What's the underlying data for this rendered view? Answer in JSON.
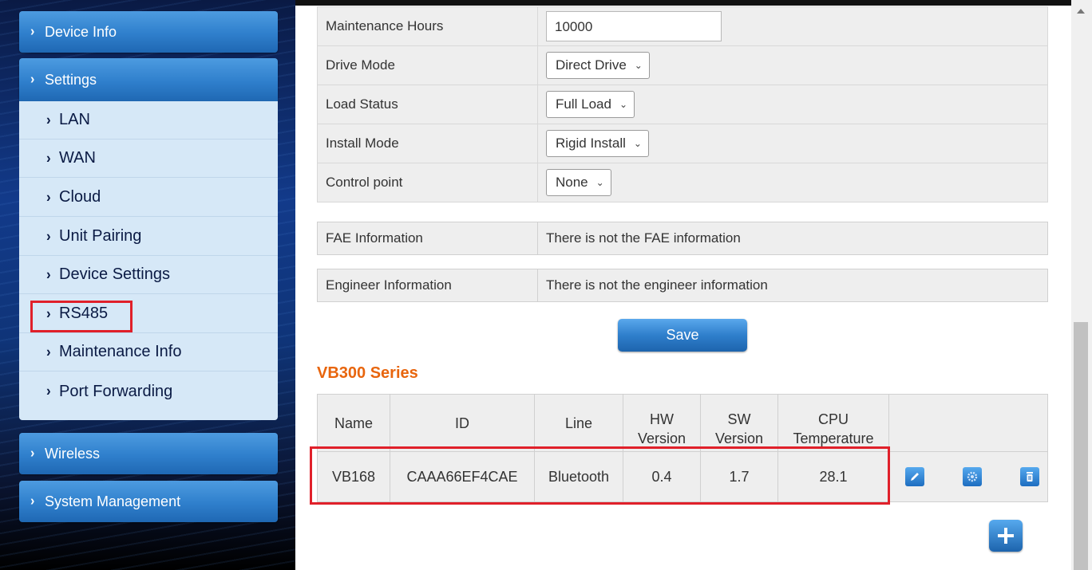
{
  "sidebar": {
    "device_info": "Device Info",
    "settings": "Settings",
    "settings_items": [
      "LAN",
      "WAN",
      "Cloud",
      "Unit Pairing",
      "Device Settings",
      "RS485",
      "Maintenance Info",
      "Port Forwarding"
    ],
    "wireless": "Wireless",
    "system_management": "System Management"
  },
  "form": {
    "maintenance_hours_label": "Maintenance Hours",
    "maintenance_hours_value": "10000",
    "drive_mode_label": "Drive Mode",
    "drive_mode_value": "Direct Drive",
    "load_status_label": "Load Status",
    "load_status_value": "Full Load",
    "install_mode_label": "Install Mode",
    "install_mode_value": "Rigid Install",
    "control_point_label": "Control point",
    "control_point_value": "None"
  },
  "fae": {
    "label": "FAE Information",
    "value": "There is not the FAE information"
  },
  "engineer": {
    "label": "Engineer Information",
    "value": "There is not the engineer information"
  },
  "save_label": "Save",
  "series": {
    "title": "VB300 Series",
    "headers": {
      "name": "Name",
      "id": "ID",
      "line": "Line",
      "hw_1": "HW",
      "hw_2": "Version",
      "sw_1": "SW",
      "sw_2": "Version",
      "cpu_1": "CPU",
      "cpu_2": "Temperature"
    },
    "row": {
      "name": "VB168",
      "id": "CAAA66EF4CAE",
      "line": "Bluetooth",
      "hw": "0.4",
      "sw": "1.7",
      "cpu": "28.1"
    }
  },
  "colors": {
    "accent_blue": "#2f7fcc",
    "highlight_red": "#e0202a",
    "series_title": "#e8650d"
  }
}
